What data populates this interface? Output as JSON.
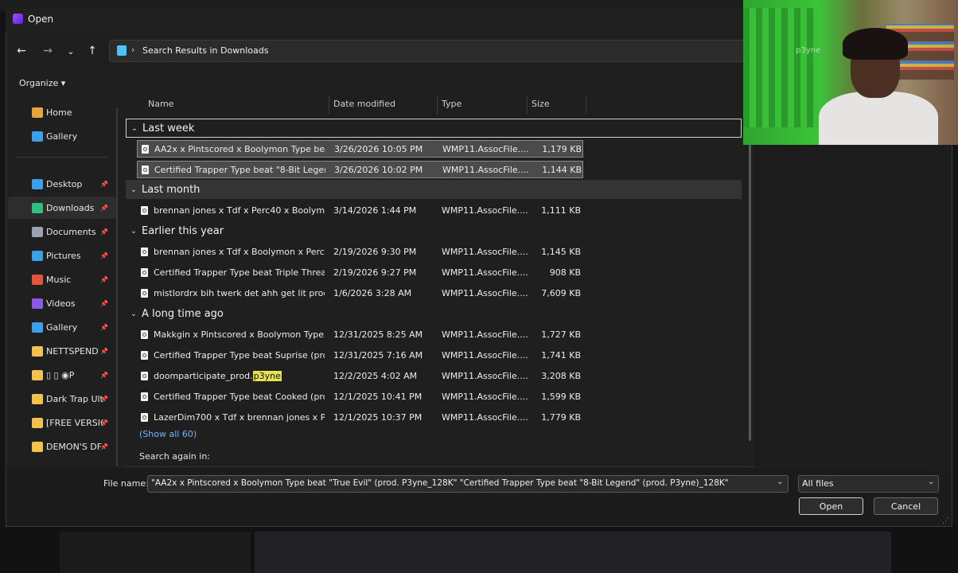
{
  "window": {
    "title": "Open"
  },
  "address": {
    "path": "Search Results in Downloads"
  },
  "toolbar": {
    "organize": "Organize ▾"
  },
  "sidebar": [
    {
      "label": "Home",
      "icon": "home-icon",
      "color": "#e8a33d",
      "pin": false
    },
    {
      "label": "Gallery",
      "icon": "gallery-icon",
      "color": "#3aa0e8",
      "pin": false
    },
    {
      "label": "Desktop",
      "icon": "desktop-icon",
      "color": "#3aa0e8",
      "pin": true
    },
    {
      "label": "Downloads",
      "icon": "download-icon",
      "color": "#2ec27e",
      "pin": true,
      "active": true
    },
    {
      "label": "Documents",
      "icon": "document-icon",
      "color": "#9aa3ad",
      "pin": true
    },
    {
      "label": "Pictures",
      "icon": "pictures-icon",
      "color": "#3aa0e8",
      "pin": true
    },
    {
      "label": "Music",
      "icon": "music-icon",
      "color": "#e2553d",
      "pin": true
    },
    {
      "label": "Videos",
      "icon": "videos-icon",
      "color": "#8a5be8",
      "pin": true
    },
    {
      "label": "Gallery",
      "icon": "gallery-icon",
      "color": "#3aa0e8",
      "pin": true
    },
    {
      "label": "NETTSPEND",
      "icon": "folder-icon",
      "color": "#f2c14e",
      "pin": true
    },
    {
      "label": "▯ ▯ ◉P",
      "icon": "folder-icon",
      "color": "#f2c14e",
      "pin": true
    },
    {
      "label": "Dark Trap Ult",
      "icon": "folder-icon",
      "color": "#f2c14e",
      "pin": true
    },
    {
      "label": "[FREE VERSIC",
      "icon": "folder-icon",
      "color": "#f2c14e",
      "pin": true
    },
    {
      "label": "DEMON'S DF",
      "icon": "folder-icon",
      "color": "#f2c14e",
      "pin": true
    }
  ],
  "columns": {
    "name": "Name",
    "date": "Date modified",
    "type": "Type",
    "size": "Size"
  },
  "groups": [
    {
      "label": "Last week",
      "files": [
        {
          "name": "AA2x x Pintscored x Boolymon Type beat ...",
          "date": "3/26/2026 10:05 PM",
          "type": "WMP11.AssocFile....",
          "size": "1,179 KB",
          "selected": true
        },
        {
          "name": "Certified Trapper Type beat \"8-Bit Legend...",
          "date": "3/26/2026 10:02 PM",
          "type": "WMP11.AssocFile....",
          "size": "1,144 KB",
          "selected": true
        }
      ]
    },
    {
      "label": "Last month",
      "files": [
        {
          "name": "brennan jones x Tdf x Perc40 x Boolymon...",
          "date": "3/14/2026 1:44 PM",
          "type": "WMP11.AssocFile....",
          "size": "1,111 KB"
        }
      ]
    },
    {
      "label": "Earlier this year",
      "files": [
        {
          "name": "brennan jones x Tdf x Boolymon x Perc40...",
          "date": "2/19/2026 9:30 PM",
          "type": "WMP11.AssocFile....",
          "size": "1,145 KB"
        },
        {
          "name": "Certified Trapper Type beat Triple Threat ...",
          "date": "2/19/2026 9:27 PM",
          "type": "WMP11.AssocFile....",
          "size": "908 KB"
        },
        {
          "name": "mistlordrx bih twerk det ahh get lit prod ...",
          "date": "1/6/2026 3:28 AM",
          "type": "WMP11.AssocFile....",
          "size": "7,609 KB"
        }
      ]
    },
    {
      "label": "A long time ago",
      "files": [
        {
          "name": "Makkgin x Pintscored x Boolymon Type b...",
          "date": "12/31/2025 8:25 AM",
          "type": "WMP11.AssocFile....",
          "size": "1,727 KB"
        },
        {
          "name": "Certified Trapper Type beat Suprise (prod...",
          "date": "12/31/2025 7:16 AM",
          "type": "WMP11.AssocFile....",
          "size": "1,741 KB"
        },
        {
          "name": "doomparticipate_prod.",
          "highlight": "p3yne",
          "date": "12/2/2025 4:02 AM",
          "type": "WMP11.AssocFile....",
          "size": "3,208 KB"
        },
        {
          "name": "Certified Trapper Type beat Cooked (pro...",
          "date": "12/1/2025 10:41 PM",
          "type": "WMP11.AssocFile....",
          "size": "1,599 KB"
        },
        {
          "name": "LazerDim700 x Tdf x brennan jones x Perc...",
          "date": "12/1/2025 10:37 PM",
          "type": "WMP11.AssocFile....",
          "size": "1,779 KB"
        }
      ]
    }
  ],
  "list": {
    "show_all": "(Show all 60)",
    "search_again": "Search again in:"
  },
  "footer": {
    "file_name_label": "File name:",
    "file_name_value": "\"AA2x x Pintscored x Boolymon Type beat \"True Evil\" (prod. P3yne_128K\" \"Certified Trapper Type beat \"8-Bit Legend\" (prod. P3yne)_128K\"",
    "filter": "All files",
    "open": "Open",
    "cancel": "Cancel"
  },
  "webcam": {
    "overlay_text": "p3yne"
  }
}
